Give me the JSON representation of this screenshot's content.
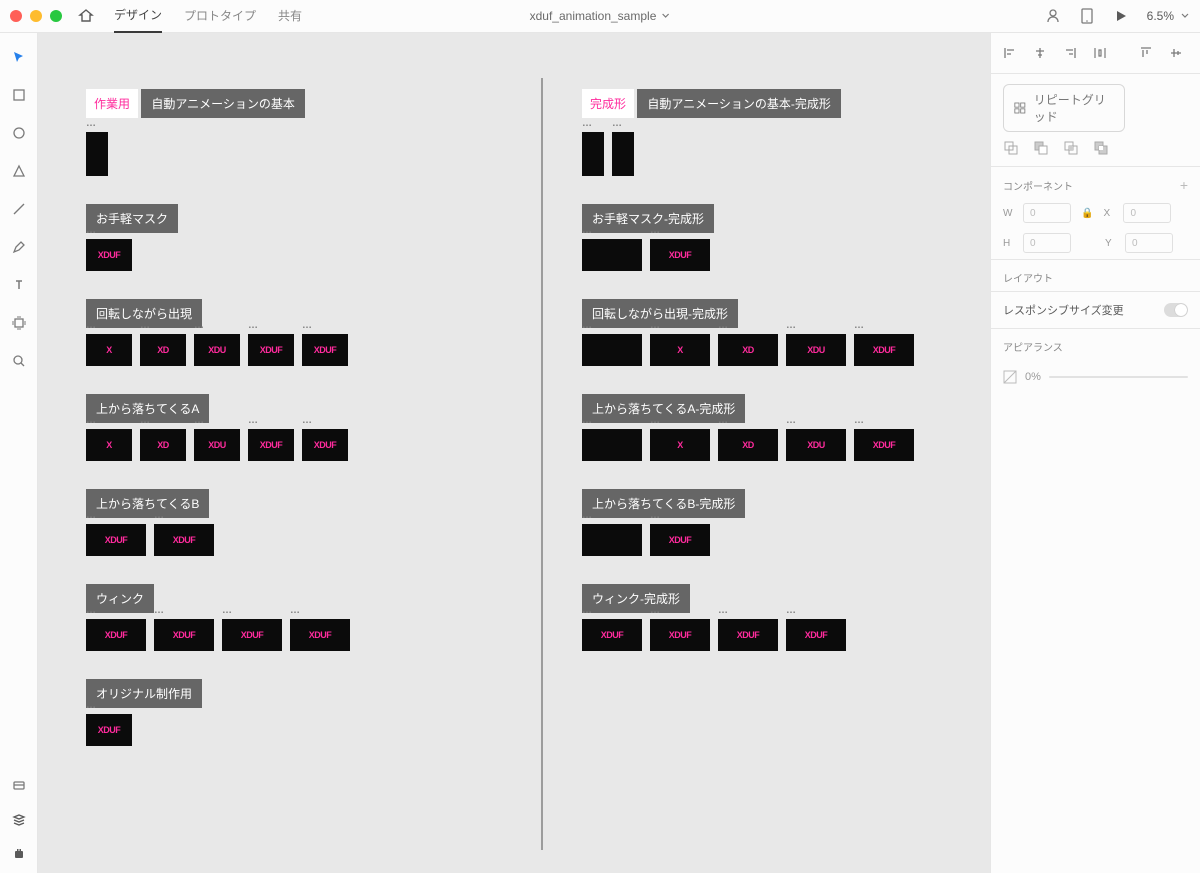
{
  "top": {
    "tab_design": "デザイン",
    "tab_proto": "プロトタイプ",
    "tab_share": "共有",
    "title": "xduf_animation_sample",
    "zoom": "6.5%"
  },
  "panel": {
    "repeat": "リピートグリッド",
    "component": "コンポーネント",
    "w_label": "W",
    "h_label": "H",
    "x_label": "X",
    "y_label": "Y",
    "w_val": "0",
    "h_val": "0",
    "x_val": "0",
    "y_val": "0",
    "layout": "レイアウト",
    "responsive": "レスポンシブサイズ変更",
    "appearance": "アピアランス",
    "opacity": "0%"
  },
  "canvas": {
    "colA": {
      "title": "作業用",
      "g1": {
        "label": "自動アニメーションの基本"
      },
      "g2": {
        "label": "お手軽マスク",
        "a": [
          "XDUF"
        ]
      },
      "g3": {
        "label": "回転しながら出現",
        "a": [
          "X",
          "XD",
          "XDU",
          "XDUF",
          "XDUF"
        ]
      },
      "g4": {
        "label": "上から落ちてくるA",
        "a": [
          "X",
          "XD",
          "XDU",
          "XDUF",
          "XDUF"
        ]
      },
      "g5": {
        "label": "上から落ちてくるB",
        "a": [
          "XDUF",
          "XDUF"
        ]
      },
      "g6": {
        "label": "ウィンク",
        "a": [
          "XDUF",
          "XDUF",
          "XDUF",
          "XDUF"
        ]
      },
      "g7": {
        "label": "オリジナル制作用",
        "a": [
          "XDUF"
        ]
      }
    },
    "colB": {
      "title": "完成形",
      "g1": {
        "label": "自動アニメーションの基本-完成形"
      },
      "g2": {
        "label": "お手軽マスク-完成形",
        "a": [
          "",
          "XDUF"
        ]
      },
      "g3": {
        "label": "回転しながら出現-完成形",
        "a": [
          "",
          "X",
          "XD",
          "XDU",
          "XDUF"
        ]
      },
      "g4": {
        "label": "上から落ちてくるA-完成形",
        "a": [
          "",
          "X",
          "XD",
          "XDU",
          "XDUF"
        ]
      },
      "g5": {
        "label": "上から落ちてくるB-完成形",
        "a": [
          "",
          "XDUF"
        ]
      },
      "g6": {
        "label": "ウィンク-完成形",
        "a": [
          "XDUF",
          "XDUF",
          "XDUF",
          "XDUF"
        ]
      }
    }
  }
}
